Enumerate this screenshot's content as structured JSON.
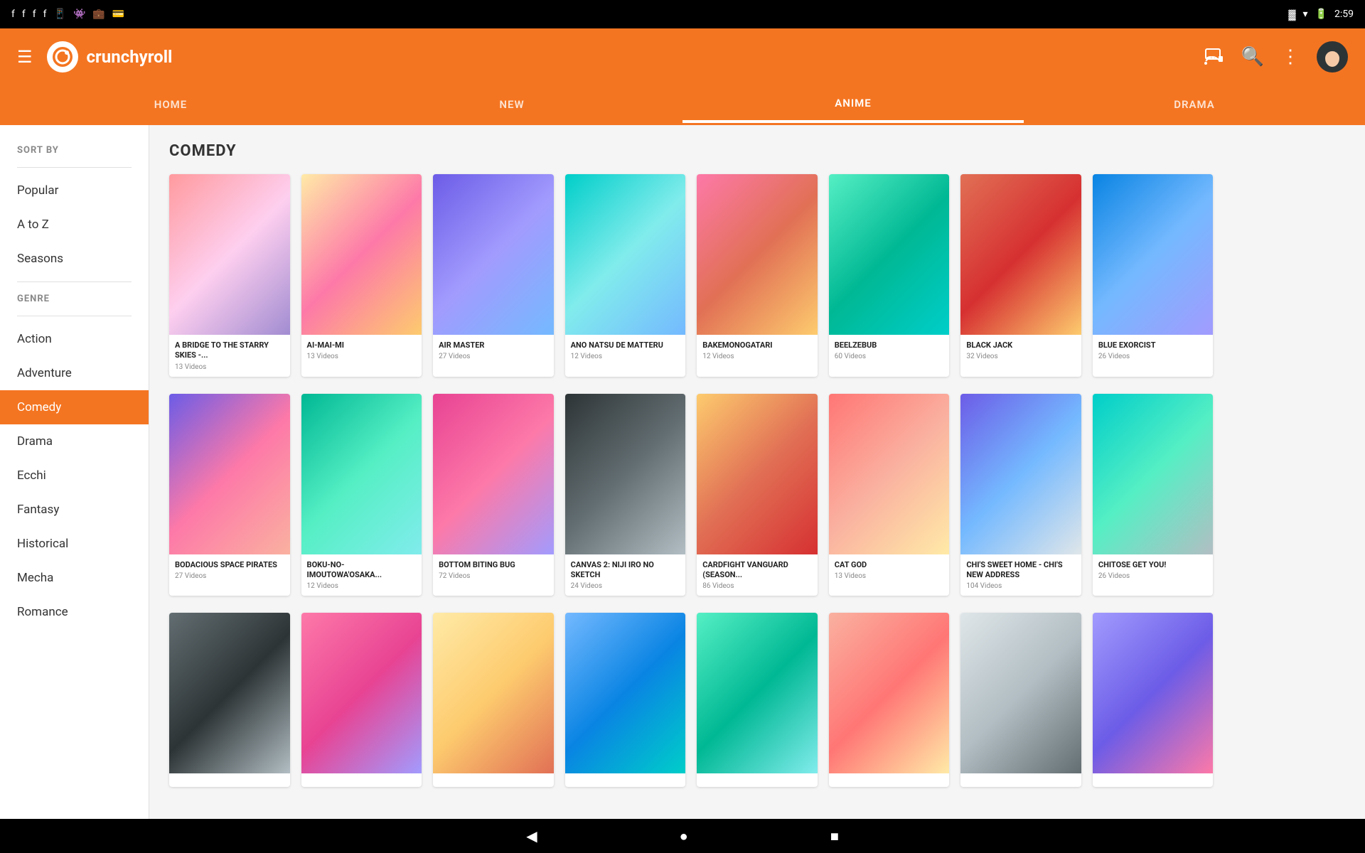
{
  "status_bar": {
    "time": "2:59",
    "icons": [
      "notification",
      "facebook1",
      "facebook2",
      "facebook3",
      "phone",
      "alien",
      "bag",
      "wallet"
    ]
  },
  "top_bar": {
    "logo_text": "crunchyroll",
    "logo_initial": "c",
    "icons": [
      "cast",
      "search",
      "more"
    ]
  },
  "nav_tabs": [
    {
      "label": "HOME",
      "active": false
    },
    {
      "label": "NEW",
      "active": false
    },
    {
      "label": "ANIME",
      "active": true
    },
    {
      "label": "DRAMA",
      "active": false
    }
  ],
  "sidebar": {
    "sort_by_label": "SORT BY",
    "sort_items": [
      {
        "label": "Popular"
      },
      {
        "label": "A to Z"
      },
      {
        "label": "Seasons"
      }
    ],
    "genre_label": "GENRE",
    "genre_items": [
      {
        "label": "Action",
        "active": false
      },
      {
        "label": "Adventure",
        "active": false
      },
      {
        "label": "Comedy",
        "active": true
      },
      {
        "label": "Drama",
        "active": false
      },
      {
        "label": "Ecchi",
        "active": false
      },
      {
        "label": "Fantasy",
        "active": false
      },
      {
        "label": "Historical",
        "active": false
      },
      {
        "label": "Mecha",
        "active": false
      },
      {
        "label": "Romance",
        "active": false
      }
    ]
  },
  "section_title": "COMEDY",
  "row1": [
    {
      "title": "A BRIDGE TO THE STARRY SKIES -...",
      "videos": "13 Videos",
      "thumb": "thumb-1"
    },
    {
      "title": "AI-MAI-MI",
      "videos": "13 Videos",
      "thumb": "thumb-2"
    },
    {
      "title": "AIR MASTER",
      "videos": "27 Videos",
      "thumb": "thumb-3"
    },
    {
      "title": "ANO NATSU DE MATTERU",
      "videos": "12 Videos",
      "thumb": "thumb-4"
    },
    {
      "title": "BAKEMONOGATARI",
      "videos": "12 Videos",
      "thumb": "thumb-5"
    },
    {
      "title": "BEELZEBUB",
      "videos": "60 Videos",
      "thumb": "thumb-6"
    },
    {
      "title": "BLACK JACK",
      "videos": "32 Videos",
      "thumb": "thumb-7"
    },
    {
      "title": "BLUE EXORCIST",
      "videos": "26 Videos",
      "thumb": "thumb-8"
    }
  ],
  "row2": [
    {
      "title": "BODACIOUS SPACE PIRATES",
      "videos": "27 Videos",
      "thumb": "thumb-9"
    },
    {
      "title": "BOKU-NO-IMOUTOWA'OSAKA...",
      "videos": "12 Videos",
      "thumb": "thumb-10"
    },
    {
      "title": "BOTTOM BITING BUG",
      "videos": "72 Videos",
      "thumb": "thumb-11"
    },
    {
      "title": "CANVAS 2: NIJI IRO NO SKETCH",
      "videos": "24 Videos",
      "thumb": "thumb-12"
    },
    {
      "title": "CARDFIGHT VANGUARD (SEASON...",
      "videos": "86 Videos",
      "thumb": "thumb-13"
    },
    {
      "title": "CAT GOD",
      "videos": "13 Videos",
      "thumb": "thumb-14"
    },
    {
      "title": "CHI'S SWEET HOME - CHI'S NEW ADDRESS",
      "videos": "104 Videos",
      "thumb": "thumb-15"
    },
    {
      "title": "CHITOSE GET YOU!",
      "videos": "26 Videos",
      "thumb": "thumb-16"
    }
  ],
  "row3": [
    {
      "title": "",
      "videos": "",
      "thumb": "thumb-r1"
    },
    {
      "title": "",
      "videos": "",
      "thumb": "thumb-r2"
    },
    {
      "title": "",
      "videos": "",
      "thumb": "thumb-r3"
    },
    {
      "title": "",
      "videos": "",
      "thumb": "thumb-r4"
    },
    {
      "title": "",
      "videos": "",
      "thumb": "thumb-r5"
    },
    {
      "title": "",
      "videos": "",
      "thumb": "thumb-r6"
    },
    {
      "title": "",
      "videos": "",
      "thumb": "thumb-r7"
    },
    {
      "title": "",
      "videos": "",
      "thumb": "thumb-r8"
    }
  ],
  "bottom_bar": {
    "back": "◀",
    "home": "●",
    "square": "■"
  }
}
